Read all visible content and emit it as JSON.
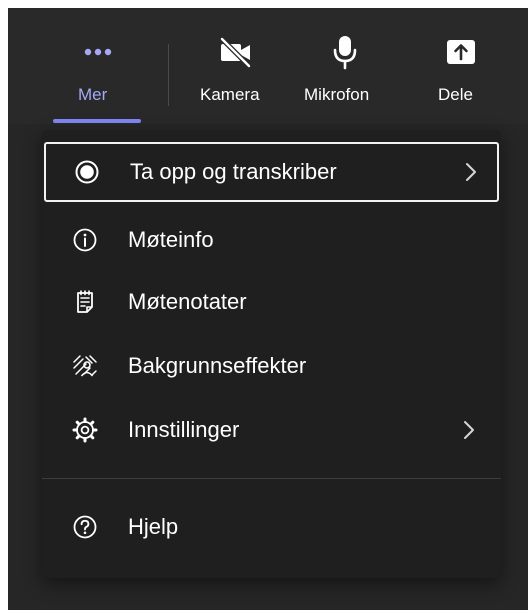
{
  "toolbar": {
    "buttons": [
      {
        "id": "more",
        "label": "Mer",
        "icon": "more-dots-icon",
        "active": true
      },
      {
        "id": "camera",
        "label": "Kamera",
        "icon": "camera-off-icon"
      },
      {
        "id": "microphone",
        "label": "Mikrofon",
        "icon": "microphone-icon"
      },
      {
        "id": "share",
        "label": "Dele",
        "icon": "share-screen-icon"
      }
    ]
  },
  "menu": {
    "items": [
      {
        "label": "Ta opp og transkriber",
        "icon": "record-icon",
        "has_submenu": true,
        "focused": true
      },
      {
        "label": "Møteinfo",
        "icon": "info-icon"
      },
      {
        "label": "Møtenotater",
        "icon": "notes-icon"
      },
      {
        "label": "Bakgrunnseffekter",
        "icon": "background-effects-icon"
      },
      {
        "label": "Innstillinger",
        "icon": "settings-gear-icon",
        "has_submenu": true
      },
      {
        "label": "Hjelp",
        "icon": "help-icon"
      }
    ]
  },
  "colors": {
    "accent": "#7f85f5",
    "accent_text": "#a5a8f6",
    "toolbar_bg": "#292929",
    "menu_bg": "#1f1f1f",
    "text": "#ffffff"
  }
}
